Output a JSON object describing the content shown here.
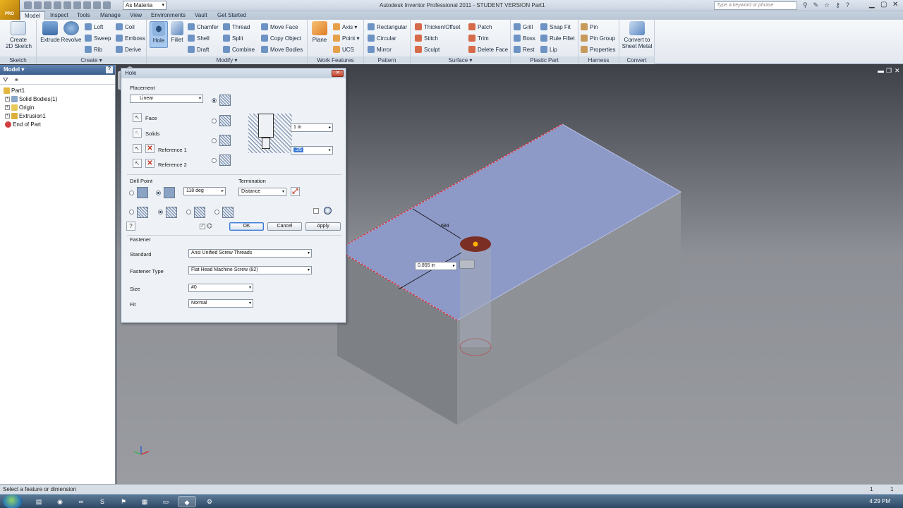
{
  "app": {
    "logo_text": "PRO",
    "title": "Autodesk Inventor Professional 2011 - STUDENT VERSION    Part1",
    "material": "As Materia",
    "help_placeholder": "Type a keyword or phrase"
  },
  "menu_tabs": [
    "Model",
    "Inspect",
    "Tools",
    "Manage",
    "View",
    "Environments",
    "Vault",
    "Get Started"
  ],
  "ribbon": {
    "sketch": {
      "label": "Sketch",
      "create_sketch": "Create\n2D Sketch"
    },
    "create": {
      "label": "Create ▾",
      "extrude": "Extrude",
      "revolve": "Revolve",
      "loft": "Loft",
      "sweep": "Sweep",
      "rib": "Rib",
      "coil": "Coil",
      "emboss": "Emboss",
      "derive": "Derive"
    },
    "modify": {
      "label": "Modify ▾",
      "hole": "Hole",
      "fillet": "Fillet",
      "chamfer": "Chamfer",
      "shell": "Shell",
      "draft": "Draft",
      "thread": "Thread",
      "split": "Split",
      "combine": "Combine",
      "move_face": "Move Face",
      "copy_object": "Copy Object",
      "move_bodies": "Move Bodies"
    },
    "work_features": {
      "label": "Work Features",
      "plane": "Plane",
      "axis": "Axis ▾",
      "point": "Point ▾",
      "ucs": "UCS"
    },
    "pattern": {
      "label": "Pattern",
      "rectangular": "Rectangular",
      "circular": "Circular",
      "mirror": "Mirror"
    },
    "surface": {
      "label": "Surface ▾",
      "thicken": "Thicken/Offset",
      "stitch": "Stitch",
      "sculpt": "Sculpt",
      "patch": "Patch",
      "trim": "Trim",
      "delete_face": "Delete Face"
    },
    "plastic_part": {
      "label": "Plastic Part",
      "grill": "Grill",
      "boss": "Boss",
      "rest": "Rest",
      "snap_fit": "Snap Fit",
      "rule_fillet": "Rule Fillet",
      "lip": "Lip"
    },
    "harness": {
      "label": "Harness",
      "pin": "Pin",
      "pin_group": "Pin Group",
      "properties": "Properties"
    },
    "convert": {
      "label": "Convert",
      "to_sheet_metal": "Convert to\nSheet Metal"
    }
  },
  "browser": {
    "title": "Model ▾",
    "help": "?",
    "tree": [
      {
        "label": "Part1",
        "icon": "part-icon",
        "indent": 0,
        "expandable": false
      },
      {
        "label": "Solid Bodies(1)",
        "icon": "solid-bodies-icon",
        "indent": 1,
        "expandable": true
      },
      {
        "label": "Origin",
        "icon": "origin-folder-icon",
        "indent": 1,
        "expandable": true
      },
      {
        "label": "Extrusion1",
        "icon": "extrusion-icon",
        "indent": 1,
        "expandable": true
      },
      {
        "label": "End of Part",
        "icon": "end-of-part-icon",
        "indent": 1,
        "expandable": false
      }
    ]
  },
  "dialog": {
    "title": "Hole",
    "placement_label": "Placement",
    "placement_type": "Linear",
    "face": "Face",
    "solids": "Solids",
    "reference1": "Reference 1",
    "reference2": "Reference 2",
    "depth_value": "1 in",
    "diameter_value": ".25",
    "drill_point_label": "Drill Point",
    "drill_angle": "118 deg",
    "termination_label": "Termination",
    "termination_value": "Distance",
    "ok": "OK",
    "cancel": "Cancel",
    "apply": "Apply",
    "help": "?",
    "fastener_label": "Fastener",
    "standard_label": "Standard",
    "standard_value": "Ansi Unified Screw Threads",
    "fastener_type_label": "Fastener Type",
    "fastener_type_value": "Flat Head Machine Screw (82)",
    "size_label": "Size",
    "size_value": "#0",
    "fit_label": "Fit",
    "fit_value": "Normal"
  },
  "viewport": {
    "dim_label": ".684",
    "dim_input": "0.855 in"
  },
  "status": {
    "message": "Select a feature or dimension",
    "count1": "1",
    "count2": "1"
  },
  "taskbar": {
    "clock": "4:29 PM"
  },
  "colors": {
    "selected_face": "#8d99c7",
    "edge_highlight": "#e0303a",
    "accent_blue": "#3d7bd6"
  }
}
